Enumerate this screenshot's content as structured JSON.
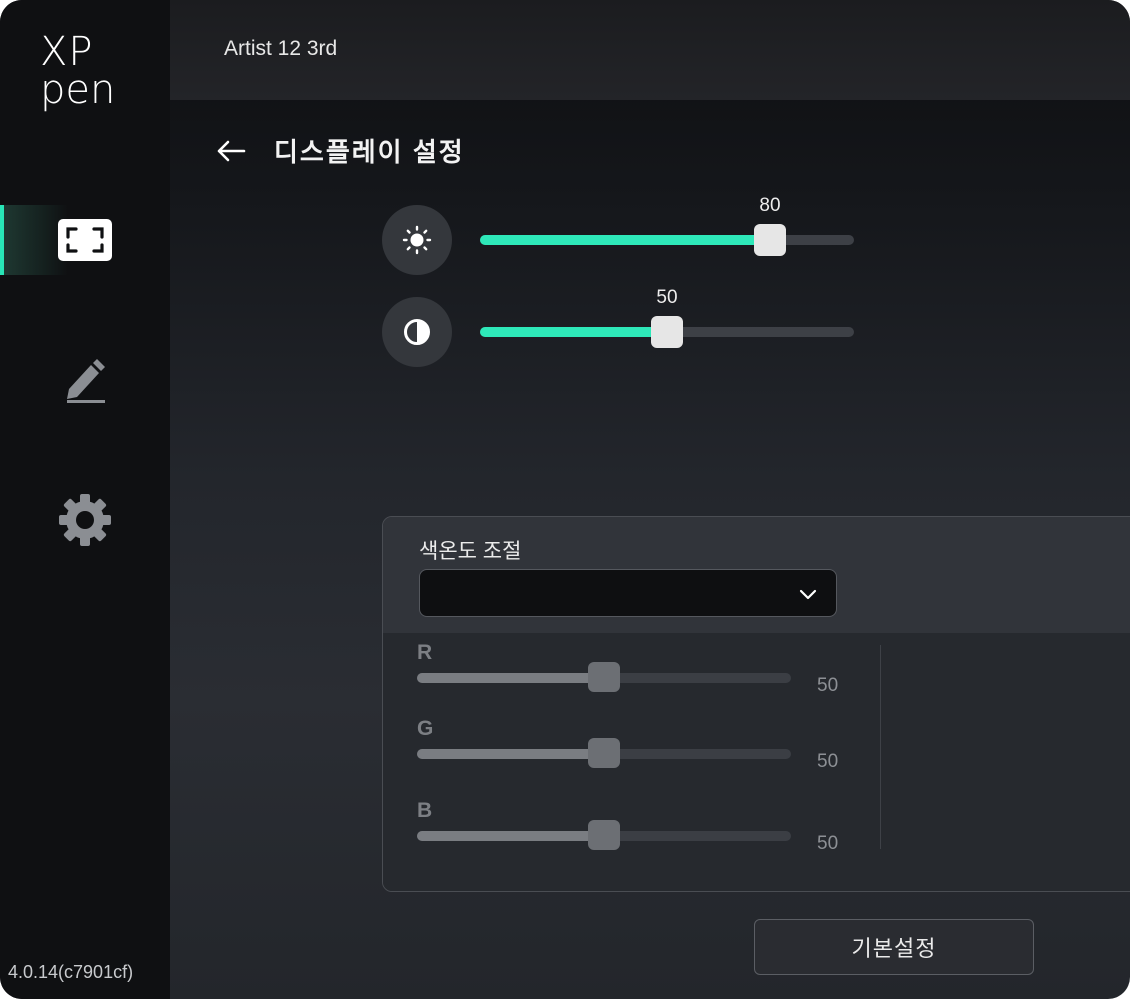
{
  "app": {
    "logo_top": "XP",
    "logo_bottom": "pen",
    "device_name": "Artist 12 3rd",
    "version": "4.0.14(c7901cf)"
  },
  "sidebar": {
    "items": [
      {
        "name": "display",
        "icon": "display-frame-icon",
        "active": true
      },
      {
        "name": "pen",
        "icon": "pen-icon",
        "active": false
      },
      {
        "name": "settings",
        "icon": "gear-icon",
        "active": false
      }
    ]
  },
  "page": {
    "title": "디스플레이 설정"
  },
  "brightness": {
    "icon": "brightness-sun-icon",
    "value": "80",
    "min": 0,
    "max": 100,
    "accent": "#2ee8b9"
  },
  "contrast": {
    "icon": "contrast-icon",
    "value": "50",
    "min": 0,
    "max": 100,
    "accent": "#2ee8b9"
  },
  "color_temp": {
    "label": "색온도 조절",
    "selected": "",
    "rgb": [
      {
        "letter": "R",
        "value": "50"
      },
      {
        "letter": "G",
        "value": "50"
      },
      {
        "letter": "B",
        "value": "50"
      }
    ]
  },
  "buttons": {
    "reset_label": "기본설정"
  }
}
